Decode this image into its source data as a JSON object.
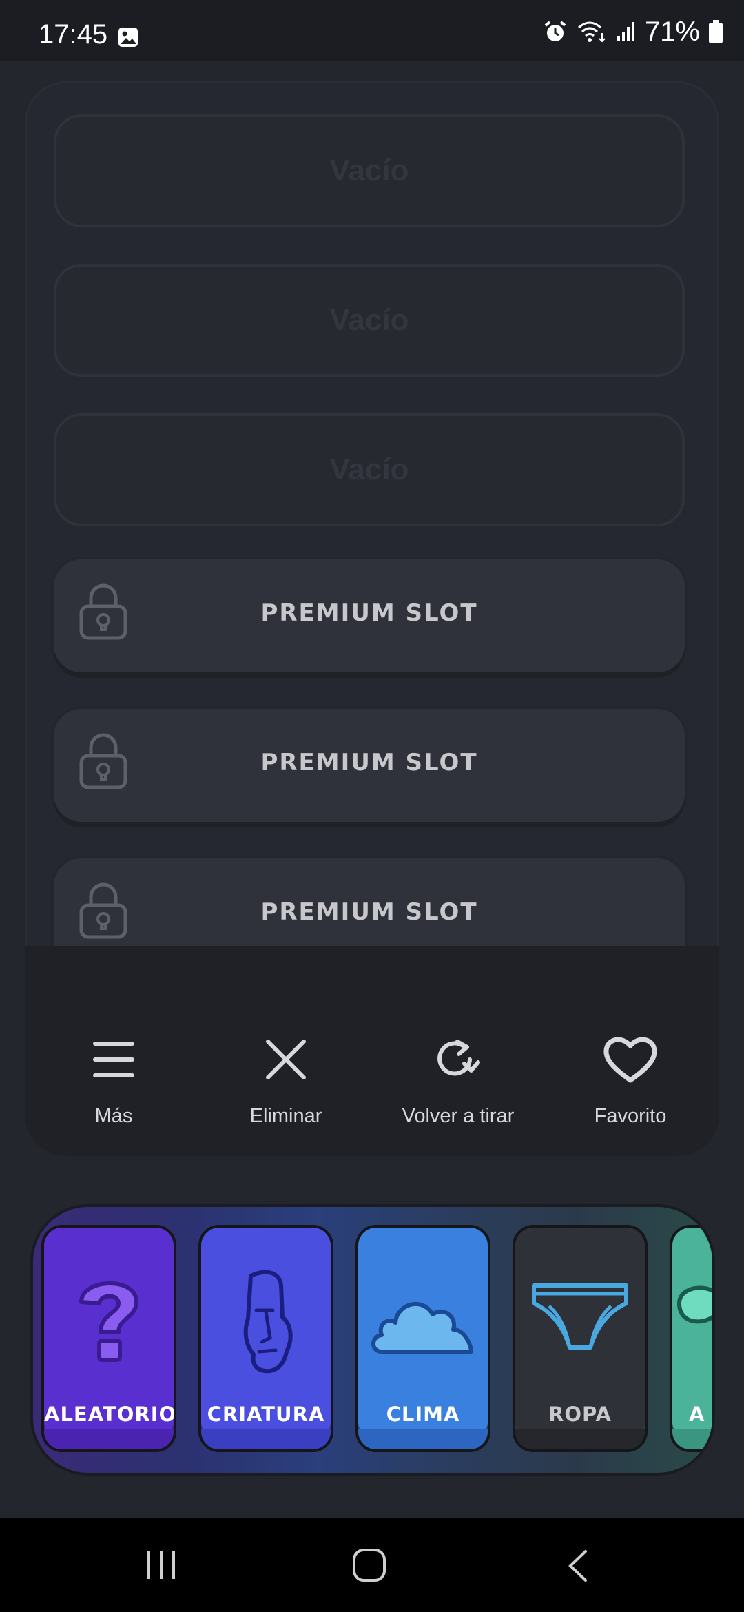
{
  "status_bar": {
    "time": "17:45",
    "battery": "71%"
  },
  "slots": {
    "empty": [
      "Vacío",
      "Vacío",
      "Vacío"
    ],
    "premium": [
      "PREMIUM SLOT",
      "PREMIUM SLOT",
      "PREMIUM SLOT"
    ]
  },
  "actions": [
    {
      "label": "Más",
      "icon": "menu-icon"
    },
    {
      "label": "Eliminar",
      "icon": "close-icon"
    },
    {
      "label": "Volver a tirar",
      "icon": "refresh-icon"
    },
    {
      "label": "Favorito",
      "icon": "heart-icon"
    }
  ],
  "categories": [
    {
      "label": "ALEATORIO",
      "icon": "question-mark-icon",
      "color": "#5a2fd0"
    },
    {
      "label": "CRIATURA",
      "icon": "moai-icon",
      "color": "#4a4fe0"
    },
    {
      "label": "CLIMA",
      "icon": "cloud-icon",
      "color": "#3a80de"
    },
    {
      "label": "ROPA",
      "icon": "underwear-icon",
      "color": "#2f3138"
    },
    {
      "label": "A",
      "icon": "partial-icon",
      "color": "#4ab39a"
    }
  ]
}
